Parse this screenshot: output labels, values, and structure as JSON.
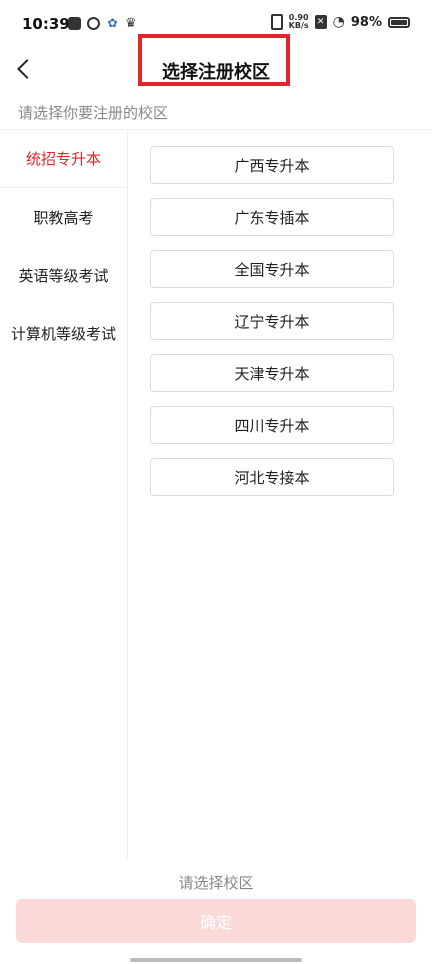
{
  "status_bar": {
    "time": "10:39",
    "speed_value": "0.90",
    "speed_unit": "KB/s",
    "battery": "98%"
  },
  "header": {
    "title": "选择注册校区"
  },
  "subtitle": "请选择你要注册的校区",
  "sidebar": {
    "items": [
      {
        "label": "统招专升本",
        "active": true
      },
      {
        "label": "职教高考",
        "active": false
      },
      {
        "label": "英语等级考试",
        "active": false
      },
      {
        "label": "计算机等级考试",
        "active": false
      }
    ]
  },
  "campuses": [
    "广西专升本",
    "广东专插本",
    "全国专升本",
    "辽宁专升本",
    "天津专升本",
    "四川专升本",
    "河北专接本"
  ],
  "footer": {
    "hint": "请选择校区",
    "confirm_label": "确定"
  },
  "colors": {
    "accent": "#e0262b",
    "confirm_disabled_bg": "#fcd9d9"
  }
}
